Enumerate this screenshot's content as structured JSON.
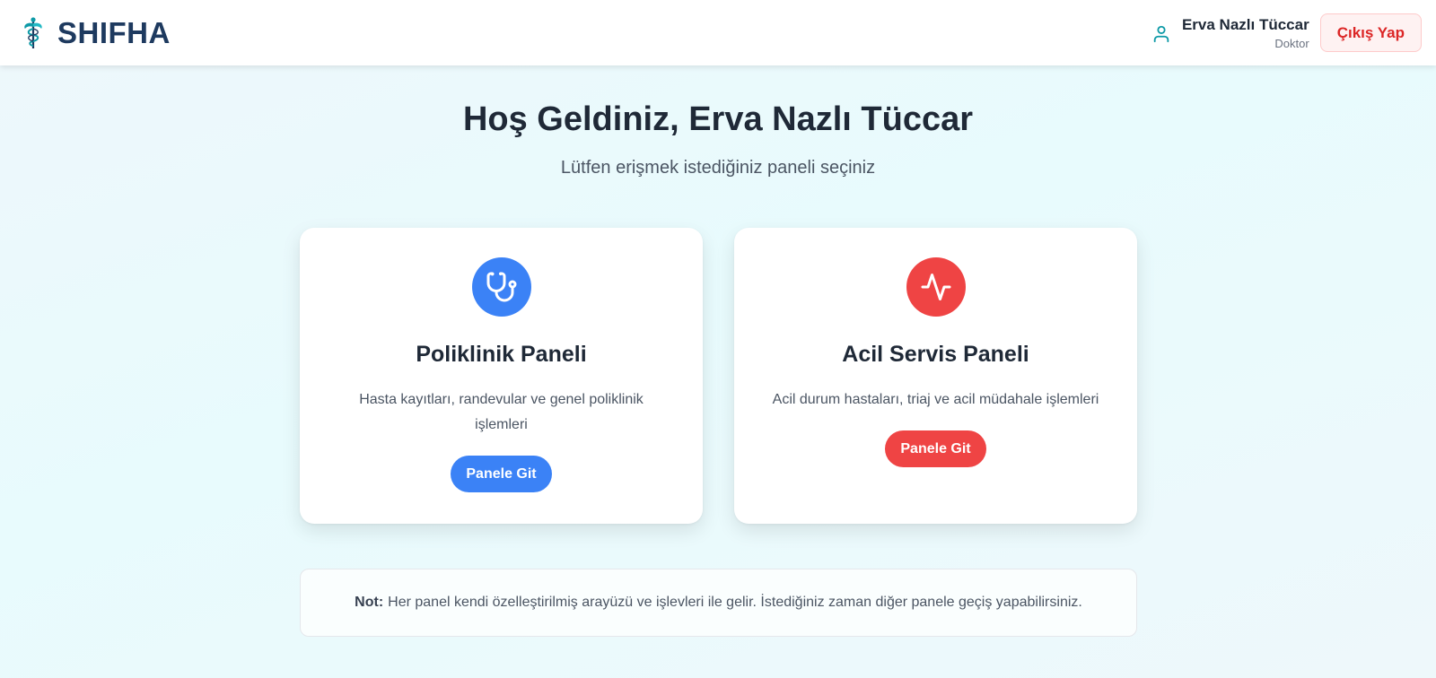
{
  "header": {
    "brand_name": "SHIFHA",
    "user_name": "Erva Nazlı Tüccar",
    "user_role": "Doktor",
    "logout_label": "Çıkış Yap"
  },
  "welcome": {
    "title": "Hoş Geldiniz, Erva Nazlı Tüccar",
    "subtitle": "Lütfen erişmek istediğiniz paneli seçiniz"
  },
  "panels": [
    {
      "icon": "stethoscope-icon",
      "color": "#3b82f6",
      "title": "Poliklinik Paneli",
      "description": "Hasta kayıtları, randevular ve genel poliklinik işlemleri",
      "button_label": "Panele Git"
    },
    {
      "icon": "activity-icon",
      "color": "#ef4444",
      "title": "Acil Servis Paneli",
      "description": "Acil durum hastaları, triaj ve acil müdahale işlemleri",
      "button_label": "Panele Git"
    }
  ],
  "note": {
    "label": "Not:",
    "text": "Her panel kendi özelleştirilmiş arayüzü ve işlevleri ile gelir. İstediğiniz zaman diğer panele geçiş yapabilirsiniz."
  },
  "colors": {
    "brand": "#1e3a5f",
    "primary": "#3b82f6",
    "danger": "#ef4444",
    "logout_text": "#dc2626",
    "accent_teal": "#0e9aa7"
  }
}
